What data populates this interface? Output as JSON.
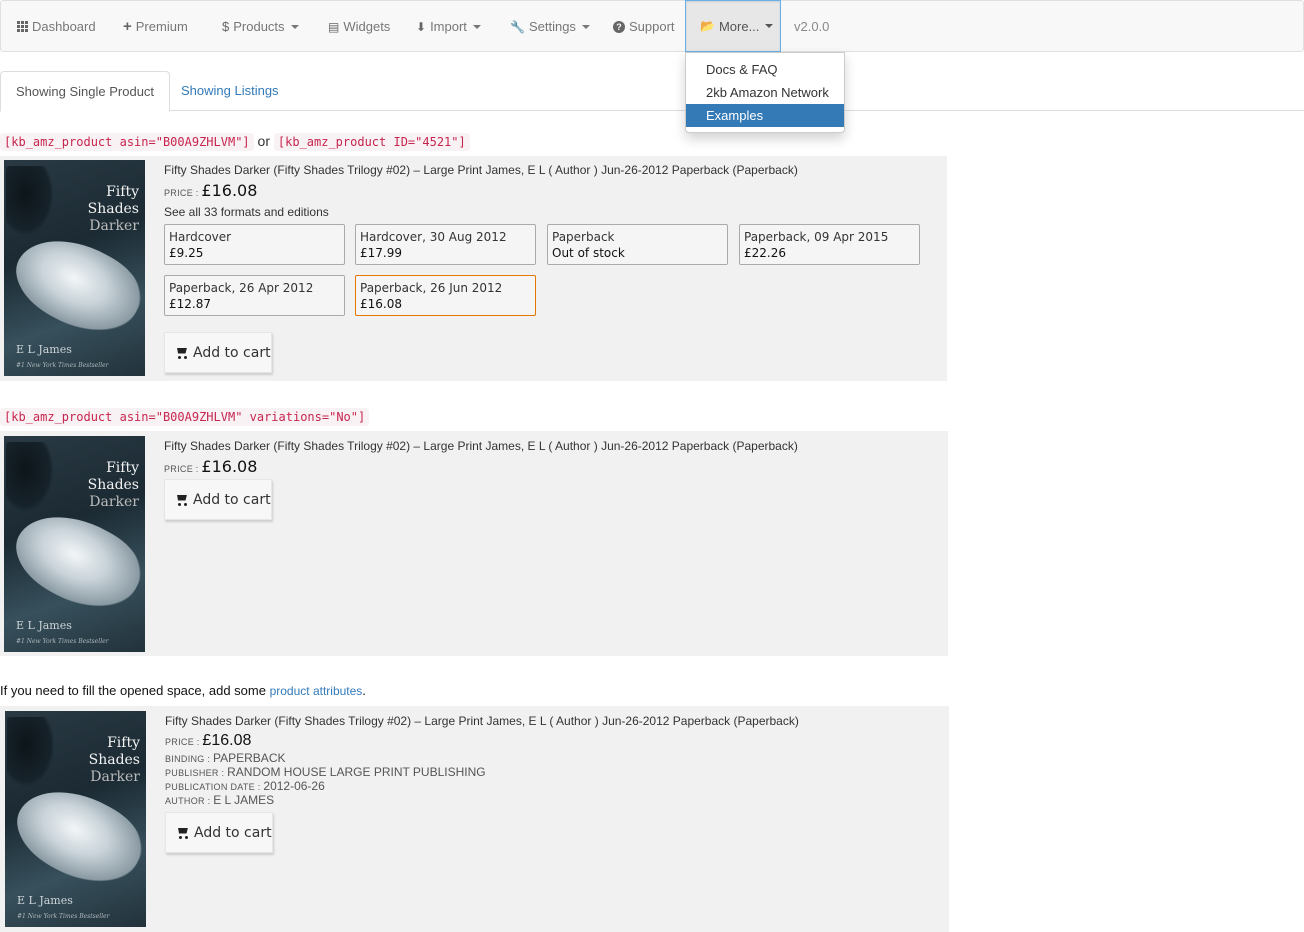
{
  "navbar": {
    "items": [
      {
        "label": "Dashboard",
        "icon": "grid-icon"
      },
      {
        "label": "Premium",
        "icon": "plus-icon"
      },
      {
        "label": "Products",
        "icon": "dollar-icon"
      },
      {
        "label": "Widgets",
        "icon": "list-icon"
      },
      {
        "label": "Import",
        "icon": "import-icon"
      },
      {
        "label": "Settings",
        "icon": "wrench-icon"
      },
      {
        "label": "Support",
        "icon": "question-circle-icon"
      },
      {
        "label": "More...",
        "icon": "folder-open-icon"
      }
    ],
    "version": "v2.0.0"
  },
  "dropdown": {
    "items": [
      "Docs & FAQ",
      "2kb Amazon Network",
      "Examples"
    ],
    "active_index": 2
  },
  "tabs": [
    "Showing Single Product",
    "Showing Listings"
  ],
  "section1": {
    "code1": "[kb_amz_product asin=\"B00A9ZHLVM\"]",
    "or": "or",
    "code2": "[kb_amz_product ID=\"4521\"]"
  },
  "section2": {
    "code": "[kb_amz_product asin=\"B00A9ZHLVM\" variations=\"No\"]"
  },
  "section3": {
    "note": "If you need to fill the opened space, add some ",
    "link": "product attributes",
    "period": "."
  },
  "product": {
    "title": "Fifty Shades Darker (Fifty Shades Trilogy #02) – Large Print James, E L ( Author ) Jun-26-2012 Paperback (Paperback)",
    "price_label": "PRICE : ",
    "price": "£16.08",
    "see_all": "See all 33 formats and editions",
    "add_to_cart": "Add to cart",
    "cover": {
      "title_line1": "Fifty",
      "title_line2": "Shades",
      "title_line3": "Darker",
      "author": "E L James",
      "tagline": "#1 New York Times Bestseller"
    },
    "formats": [
      {
        "name": "Hardcover",
        "price": "£9.25"
      },
      {
        "name": "Hardcover, 30 Aug 2012",
        "price": "£17.99"
      },
      {
        "name": "Paperback",
        "price": "Out of stock"
      },
      {
        "name": "Paperback, 09 Apr 2015",
        "price": "£22.26"
      },
      {
        "name": "Paperback, 26 Apr 2012",
        "price": "£12.87"
      },
      {
        "name": "Paperback, 26 Jun 2012",
        "price": "£16.08"
      }
    ],
    "attributes": {
      "binding_label": "BINDING : ",
      "binding": "PAPERBACK",
      "publisher_label": "PUBLISHER : ",
      "publisher": "RANDOM HOUSE LARGE PRINT PUBLISHING",
      "pubdate_label": "PUBLICATION DATE : ",
      "pubdate": "2012-06-26",
      "author_label": "AUTHOR : ",
      "author": "E L JAMES"
    }
  },
  "colors": {
    "accent": "#337ab7",
    "code_text": "#c7254e",
    "code_bg": "#f9f2f4",
    "selected_format_border": "#e77600",
    "product_bg": "#f1f1f1"
  }
}
